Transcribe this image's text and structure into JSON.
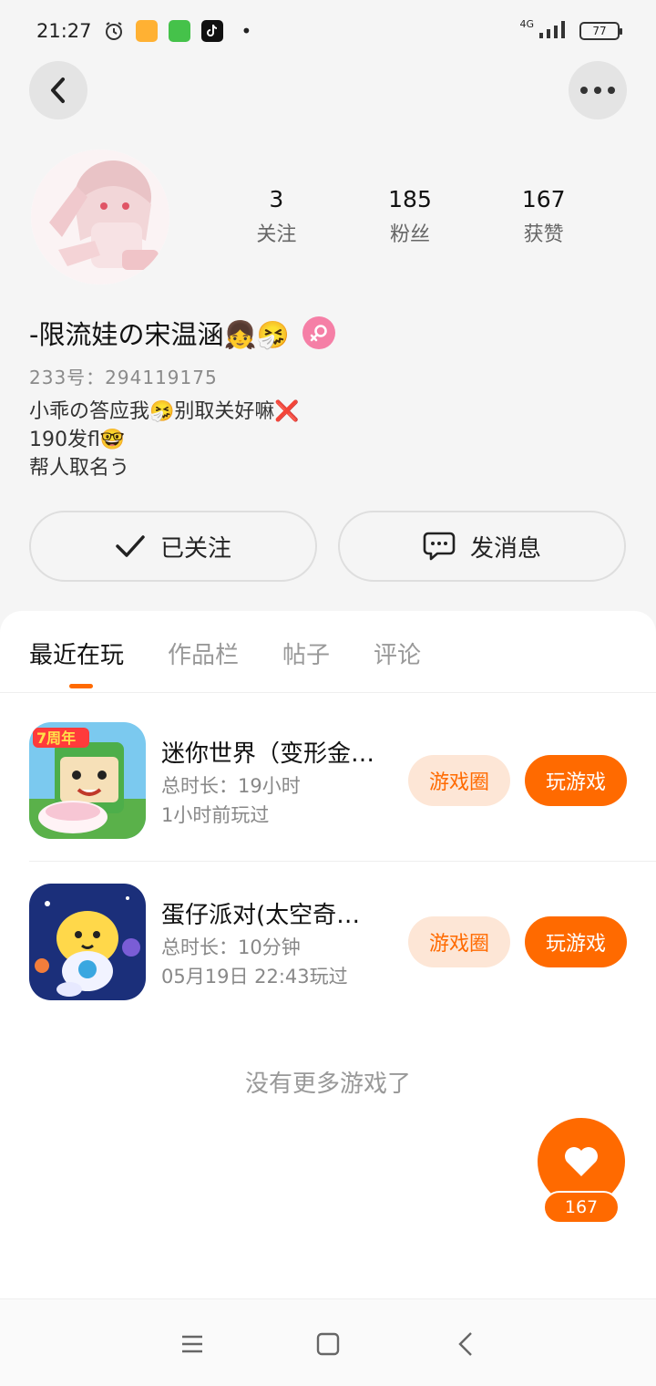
{
  "status_bar": {
    "time": "21:27",
    "network": "4G",
    "battery": "77"
  },
  "profile": {
    "stats": [
      {
        "value": "3",
        "label": "关注"
      },
      {
        "value": "185",
        "label": "粉丝"
      },
      {
        "value": "167",
        "label": "获赞"
      }
    ],
    "nickname": "-限流娃の宋温涵👧🤧",
    "user_id": "233号：294119175",
    "bio_lines": [
      "小乖の答应我🤧别取关好嘛❌",
      "190发fl🤓",
      "帮人取名う"
    ]
  },
  "actions": {
    "follow_label": "已关注",
    "message_label": "发消息"
  },
  "tabs": [
    "最近在玩",
    "作品栏",
    "帖子",
    "评论"
  ],
  "games": [
    {
      "title": "迷你世界（变形金…",
      "duration": "总时长：19小时",
      "last_played": "1小时前玩过",
      "circle_label": "游戏圈",
      "play_label": "玩游戏"
    },
    {
      "title": "蛋仔派对(太空奇…",
      "duration": "总时长：10分钟",
      "last_played": "05月19日 22:43玩过",
      "circle_label": "游戏圈",
      "play_label": "玩游戏"
    }
  ],
  "no_more_text": "没有更多游戏了",
  "like_count": "167",
  "colors": {
    "accent": "#ff6a00",
    "accent_light": "#fde6d6",
    "gender_female": "#f57fa6"
  },
  "icons": {
    "back": "chevron-left-icon",
    "more": "more-dots-icon",
    "follow": "checkmark-icon",
    "message": "chat-bubble-icon",
    "like": "heart-icon",
    "gender": "female-icon"
  }
}
